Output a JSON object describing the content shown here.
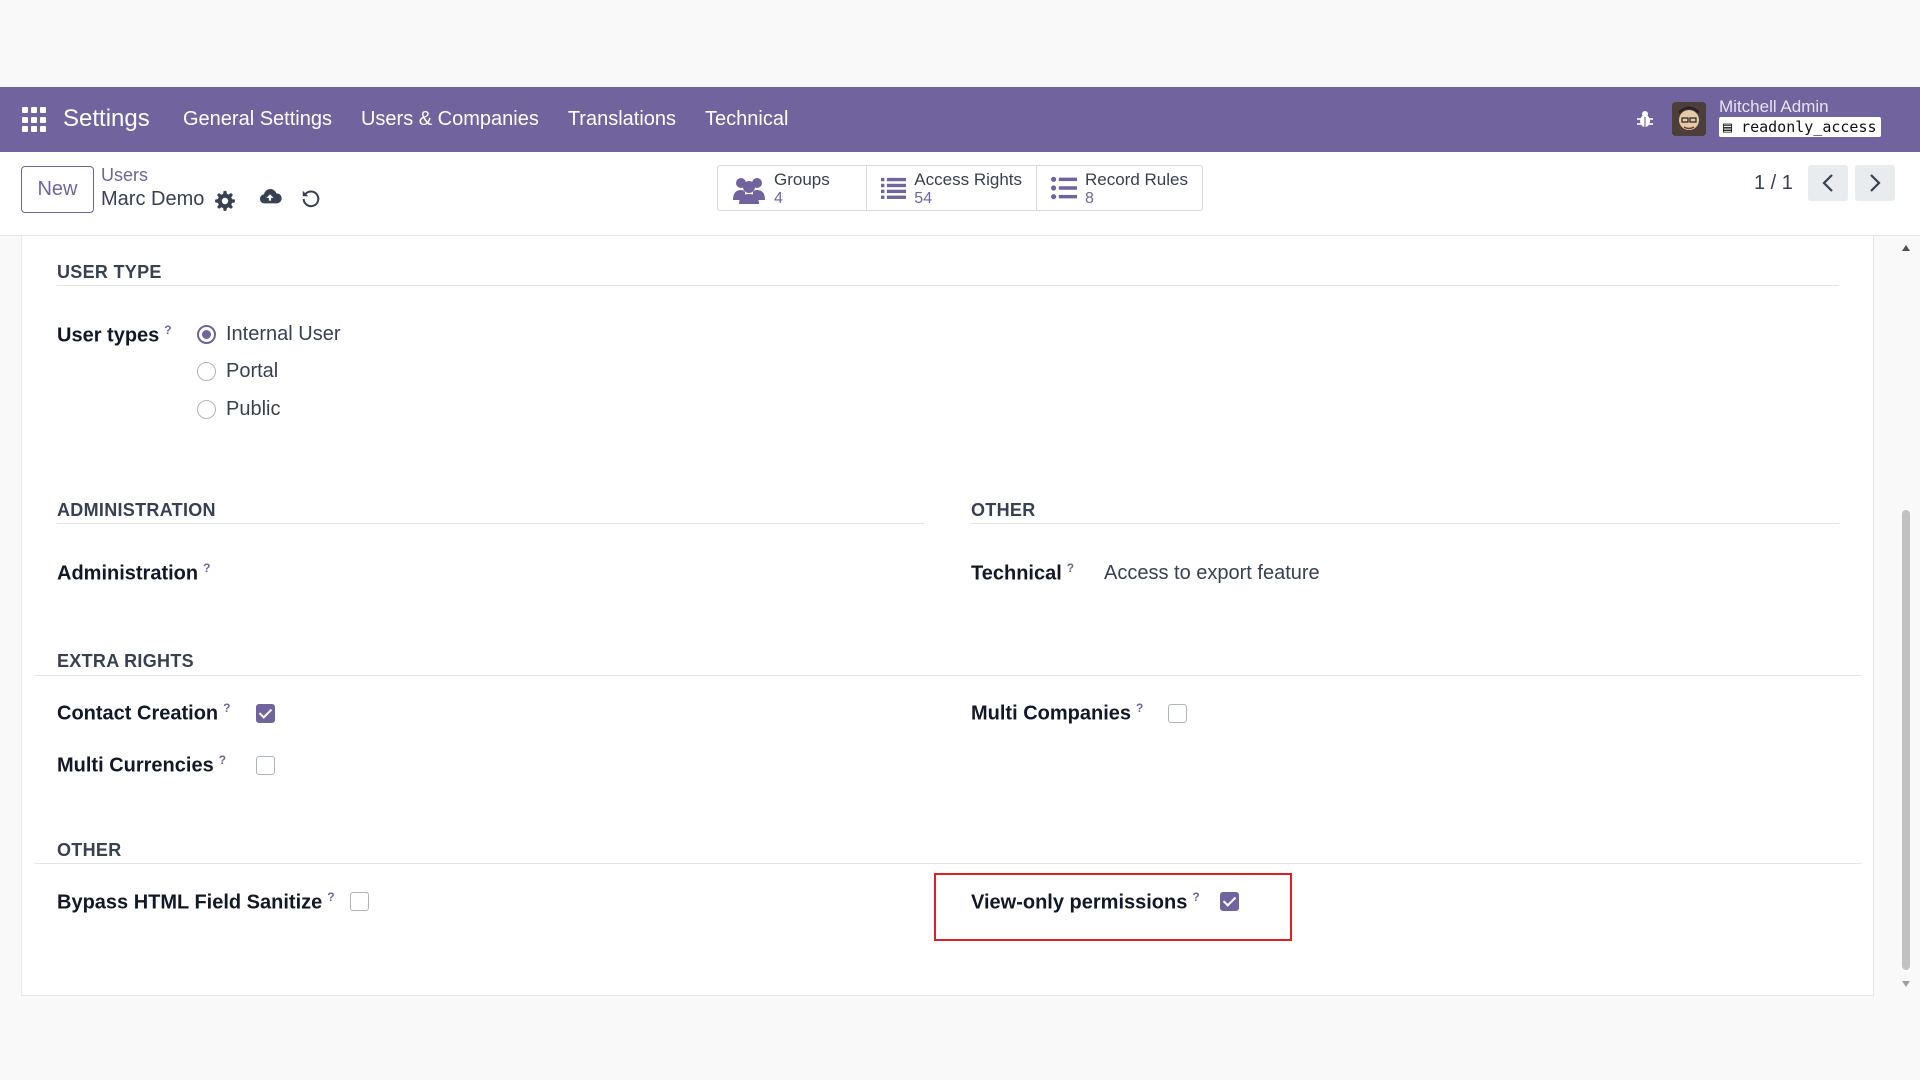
{
  "navbar": {
    "app_name": "Settings",
    "menu": [
      "General Settings",
      "Users & Companies",
      "Translations",
      "Technical"
    ],
    "user_name": "Mitchell Admin",
    "database": "readonly_access",
    "color": "#71639e"
  },
  "control_panel": {
    "new_label": "New",
    "breadcrumb_parent": "Users",
    "breadcrumb_current": "Marc Demo",
    "smart_buttons": [
      {
        "label": "Groups",
        "count": "4",
        "icon": "users-icon"
      },
      {
        "label": "Access Rights",
        "count": "54",
        "icon": "list-icon"
      },
      {
        "label": "Record Rules",
        "count": "8",
        "icon": "list-icon"
      }
    ],
    "pager": "1 / 1"
  },
  "form": {
    "user_type": {
      "title": "USER TYPE",
      "label": "User types",
      "help": "?",
      "options": [
        "Internal User",
        "Portal",
        "Public"
      ],
      "selected": "Internal User"
    },
    "administration": {
      "title": "ADMINISTRATION",
      "label": "Administration",
      "help": "?"
    },
    "other_top": {
      "title": "OTHER",
      "label": "Technical",
      "help": "?",
      "value": "Access to export feature"
    },
    "extra_rights": {
      "title": "EXTRA RIGHTS",
      "contact_creation": {
        "label": "Contact Creation",
        "help": "?",
        "checked": true
      },
      "multi_currencies": {
        "label": "Multi Currencies",
        "help": "?",
        "checked": false
      },
      "multi_companies": {
        "label": "Multi Companies",
        "help": "?",
        "checked": false
      }
    },
    "other_bottom": {
      "title": "OTHER",
      "bypass_html": {
        "label": "Bypass HTML Field Sanitize",
        "help": "?",
        "checked": false
      },
      "view_only": {
        "label": "View-only permissions",
        "help": "?",
        "checked": true
      }
    }
  }
}
